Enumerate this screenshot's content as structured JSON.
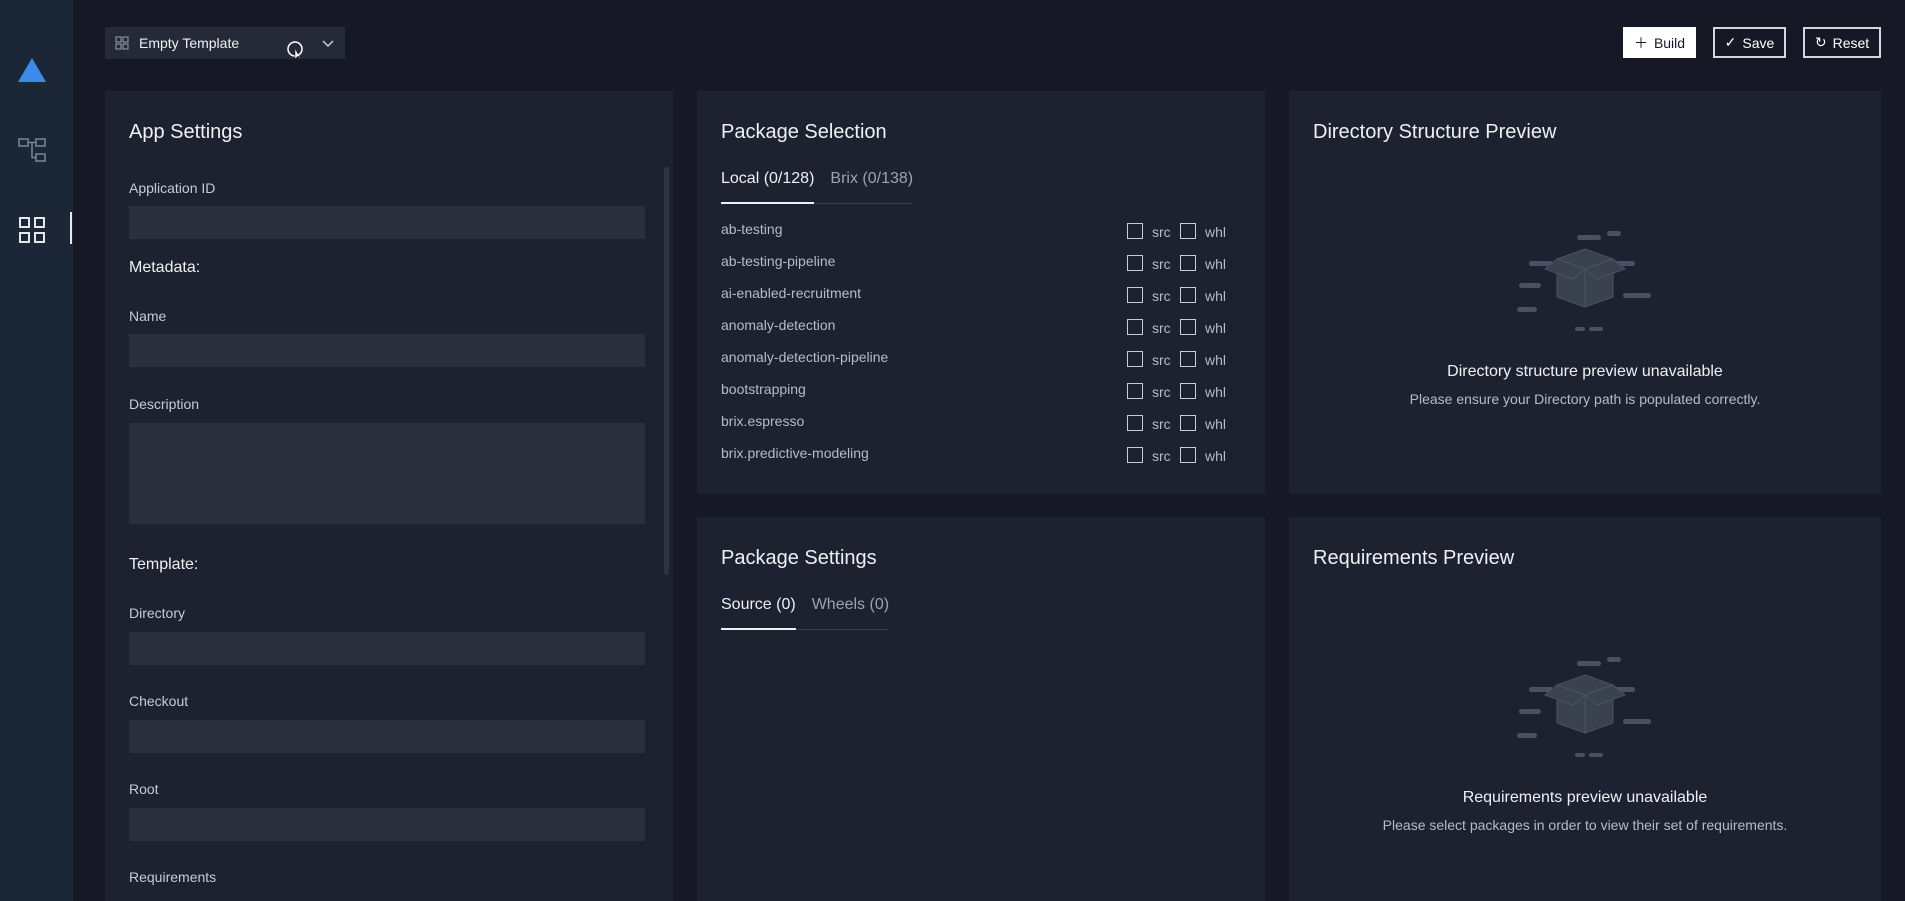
{
  "template_selector": {
    "value": "Empty Template"
  },
  "toolbar": {
    "build_label": "Build",
    "save_label": "Save",
    "reset_label": "Reset"
  },
  "app_settings": {
    "title": "App Settings",
    "application_id_label": "Application ID",
    "metadata_label": "Metadata:",
    "name_label": "Name",
    "description_label": "Description",
    "template_label": "Template:",
    "directory_label": "Directory",
    "checkout_label": "Checkout",
    "root_label": "Root",
    "requirements_label": "Requirements"
  },
  "package_selection": {
    "title": "Package Selection",
    "tabs": [
      "Local (0/128)",
      "Brix (0/138)"
    ],
    "src_label": "src",
    "whl_label": "whl",
    "packages": [
      "ab-testing",
      "ab-testing-pipeline",
      "ai-enabled-recruitment",
      "anomaly-detection",
      "anomaly-detection-pipeline",
      "bootstrapping",
      "brix.espresso",
      "brix.predictive-modeling"
    ]
  },
  "directory_preview": {
    "title": "Directory Structure Preview",
    "empty_title": "Directory structure preview unavailable",
    "empty_sub": "Please ensure your Directory path is populated correctly."
  },
  "package_settings": {
    "title": "Package Settings",
    "tabs": [
      "Source (0)",
      "Wheels (0)"
    ]
  },
  "requirements_preview": {
    "title": "Requirements Preview",
    "empty_title": "Requirements preview unavailable",
    "empty_sub": "Please select packages in order to view their set of requirements."
  },
  "colors": {
    "background": "#161925",
    "panel": "#1e2230",
    "rail": "#1b2636",
    "accent": "#3b8beb"
  },
  "icons": [
    "logo-triangle-icon",
    "hierarchy-icon",
    "grid-icon",
    "chevron-down-icon",
    "plus-icon",
    "check-icon",
    "refresh-icon",
    "empty-box-icon"
  ]
}
